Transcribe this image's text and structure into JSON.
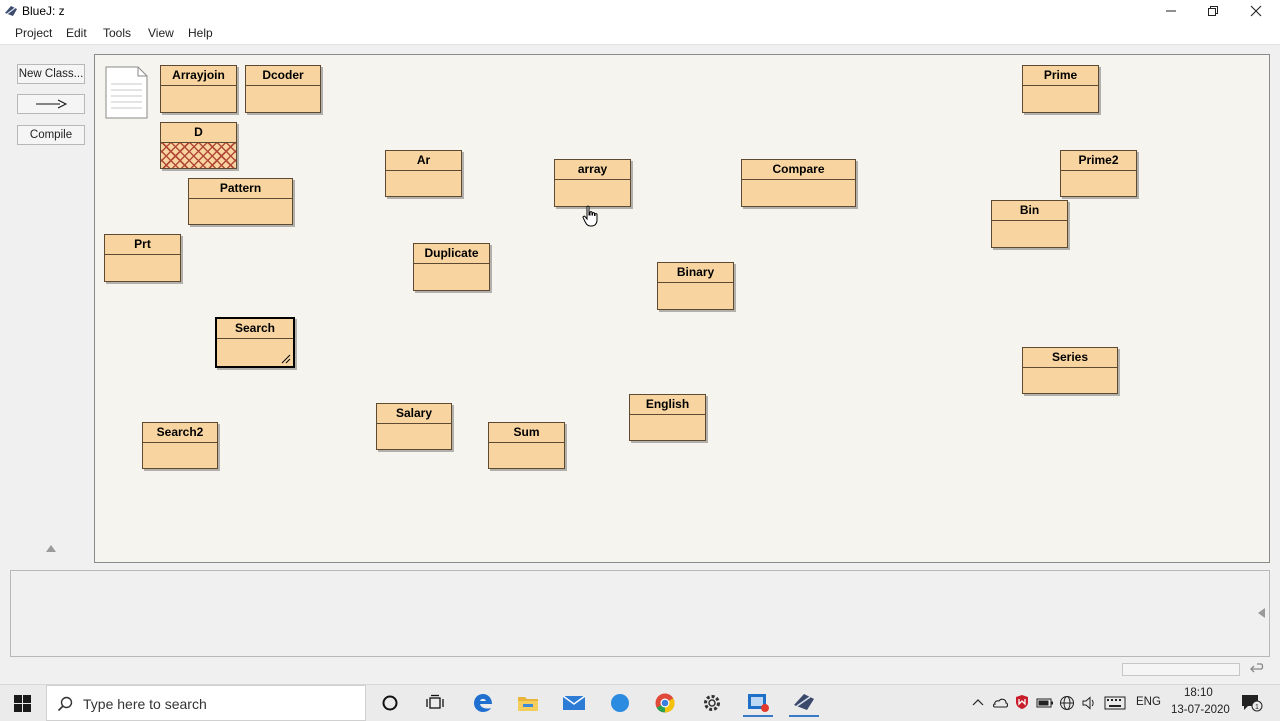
{
  "window": {
    "title": "BlueJ: z"
  },
  "menu": [
    "Project",
    "Edit",
    "Tools",
    "View",
    "Help"
  ],
  "toolbar": {
    "new_class": "New Class...",
    "compile": "Compile"
  },
  "classes": [
    {
      "name": "Arrayjoin"
    },
    {
      "name": "Dcoder"
    },
    {
      "name": "D"
    },
    {
      "name": "Pattern"
    },
    {
      "name": "Prt"
    },
    {
      "name": "Search"
    },
    {
      "name": "Search2"
    },
    {
      "name": "Ar"
    },
    {
      "name": "Duplicate"
    },
    {
      "name": "Salary"
    },
    {
      "name": "Sum"
    },
    {
      "name": "array"
    },
    {
      "name": "Binary"
    },
    {
      "name": "English"
    },
    {
      "name": "Compare"
    },
    {
      "name": "Prime"
    },
    {
      "name": "Prime2"
    },
    {
      "name": "Bin"
    },
    {
      "name": "Series"
    }
  ],
  "taskbar": {
    "search_placeholder": "Type here to search"
  },
  "tray": {
    "lang": "ENG",
    "time": "18:10",
    "date": "13-07-2020"
  },
  "colors": {
    "class_fill": "#f8d4a0",
    "canvas": "#f6f4ee",
    "hatch": "#b24a3a"
  },
  "icons": [
    "bluej-icon",
    "minimize-icon",
    "maximize-icon",
    "close-icon",
    "arrow-icon",
    "readme-icon",
    "hand-cursor-icon",
    "windows-start-icon",
    "search-icon",
    "cortana-icon",
    "task-view-icon",
    "edge-icon",
    "file-explorer-icon",
    "mail-icon",
    "chrome-icon",
    "settings-icon",
    "bluej-taskbar-icon"
  ]
}
